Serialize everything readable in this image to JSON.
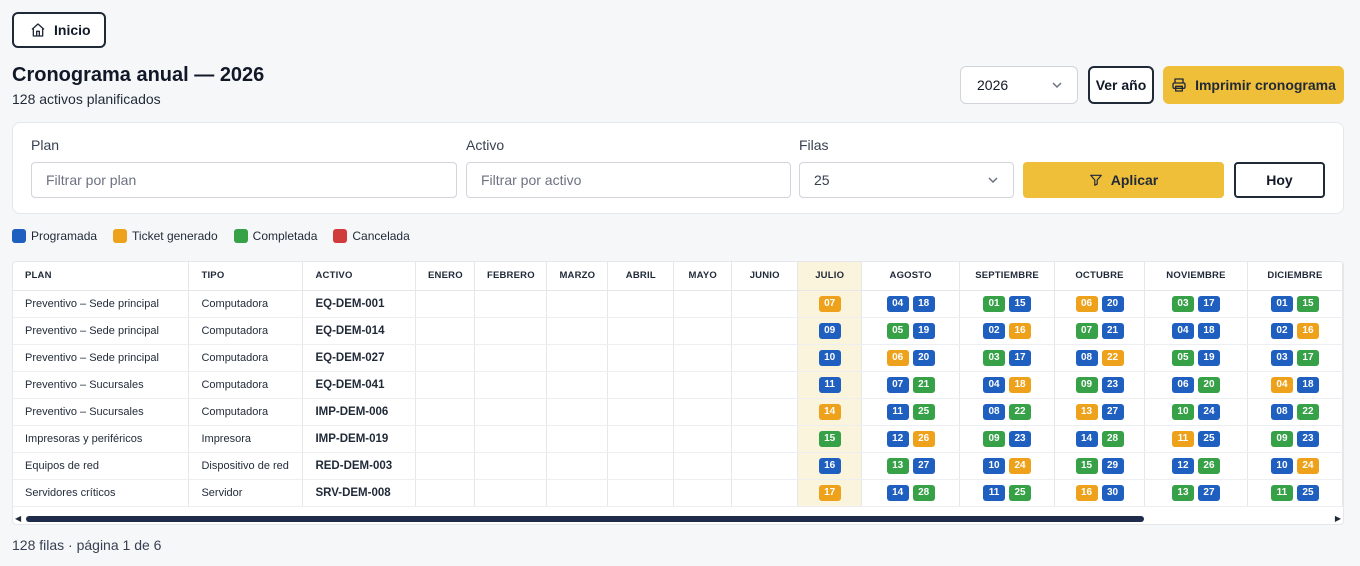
{
  "nav": {
    "home_label": "Inicio"
  },
  "header": {
    "title": "Cronograma anual — 2026",
    "subtitle": "128 activos planificados",
    "year_value": "2026",
    "ver_label": "Ver año",
    "print_label": "Imprimir cronograma"
  },
  "filters": {
    "plan_label": "Plan",
    "plan_placeholder": "Filtrar por plan",
    "activo_label": "Activo",
    "activo_placeholder": "Filtrar por activo",
    "filas_label": "Filas",
    "filas_value": "25",
    "apply_label": "Aplicar",
    "hoy_label": "Hoy"
  },
  "colors": {
    "P": "#1f5fbf",
    "T": "#eea21b",
    "C": "#36a146",
    "X": "#d23b3b",
    "accent": "#f0bf3a"
  },
  "legend": [
    {
      "key": "P",
      "label": "Programada"
    },
    {
      "key": "T",
      "label": "Ticket generado"
    },
    {
      "key": "C",
      "label": "Completada"
    },
    {
      "key": "X",
      "label": "Cancelada"
    }
  ],
  "table": {
    "columns": {
      "plan": "PLAN",
      "tipo": "TIPO",
      "activo": "ACTIVO",
      "months": [
        "ENERO",
        "FEBRERO",
        "MARZO",
        "ABRIL",
        "MAYO",
        "JUNIO",
        "JULIO",
        "AGOSTO",
        "SEPTIEMBRE",
        "OCTUBRE",
        "NOVIEMBRE",
        "DICIEMBRE"
      ]
    },
    "rows": [
      {
        "plan": "Preventivo – Sede principal",
        "tipo": "Computadora",
        "activo": "EQ-DEM-001",
        "months": [
          [],
          [],
          [],
          [],
          [],
          [],
          [
            [
              "07",
              "T"
            ]
          ],
          [
            [
              "04",
              "P"
            ],
            [
              "18",
              "P"
            ]
          ],
          [
            [
              "01",
              "C"
            ],
            [
              "15",
              "P"
            ]
          ],
          [
            [
              "06",
              "T"
            ],
            [
              "20",
              "P"
            ]
          ],
          [
            [
              "03",
              "C"
            ],
            [
              "17",
              "P"
            ]
          ],
          [
            [
              "01",
              "P"
            ],
            [
              "15",
              "C"
            ]
          ]
        ]
      },
      {
        "plan": "Preventivo – Sede principal",
        "tipo": "Computadora",
        "activo": "EQ-DEM-014",
        "months": [
          [],
          [],
          [],
          [],
          [],
          [],
          [
            [
              "09",
              "P"
            ]
          ],
          [
            [
              "05",
              "C"
            ],
            [
              "19",
              "P"
            ]
          ],
          [
            [
              "02",
              "P"
            ],
            [
              "16",
              "T"
            ]
          ],
          [
            [
              "07",
              "C"
            ],
            [
              "21",
              "P"
            ]
          ],
          [
            [
              "04",
              "P"
            ],
            [
              "18",
              "P"
            ]
          ],
          [
            [
              "02",
              "P"
            ],
            [
              "16",
              "T"
            ]
          ]
        ]
      },
      {
        "plan": "Preventivo – Sede principal",
        "tipo": "Computadora",
        "activo": "EQ-DEM-027",
        "months": [
          [],
          [],
          [],
          [],
          [],
          [],
          [
            [
              "10",
              "P"
            ]
          ],
          [
            [
              "06",
              "T"
            ],
            [
              "20",
              "P"
            ]
          ],
          [
            [
              "03",
              "C"
            ],
            [
              "17",
              "P"
            ]
          ],
          [
            [
              "08",
              "P"
            ],
            [
              "22",
              "T"
            ]
          ],
          [
            [
              "05",
              "C"
            ],
            [
              "19",
              "P"
            ]
          ],
          [
            [
              "03",
              "P"
            ],
            [
              "17",
              "C"
            ]
          ]
        ]
      },
      {
        "plan": "Preventivo – Sucursales",
        "tipo": "Computadora",
        "activo": "EQ-DEM-041",
        "months": [
          [],
          [],
          [],
          [],
          [],
          [],
          [
            [
              "11",
              "P"
            ]
          ],
          [
            [
              "07",
              "P"
            ],
            [
              "21",
              "C"
            ]
          ],
          [
            [
              "04",
              "P"
            ],
            [
              "18",
              "T"
            ]
          ],
          [
            [
              "09",
              "C"
            ],
            [
              "23",
              "P"
            ]
          ],
          [
            [
              "06",
              "P"
            ],
            [
              "20",
              "C"
            ]
          ],
          [
            [
              "04",
              "T"
            ],
            [
              "18",
              "P"
            ]
          ]
        ]
      },
      {
        "plan": "Preventivo – Sucursales",
        "tipo": "Computadora",
        "activo": "IMP-DEM-006",
        "months": [
          [],
          [],
          [],
          [],
          [],
          [],
          [
            [
              "14",
              "T"
            ]
          ],
          [
            [
              "11",
              "P"
            ],
            [
              "25",
              "C"
            ]
          ],
          [
            [
              "08",
              "P"
            ],
            [
              "22",
              "C"
            ]
          ],
          [
            [
              "13",
              "T"
            ],
            [
              "27",
              "P"
            ]
          ],
          [
            [
              "10",
              "C"
            ],
            [
              "24",
              "P"
            ]
          ],
          [
            [
              "08",
              "P"
            ],
            [
              "22",
              "C"
            ]
          ]
        ]
      },
      {
        "plan": "Impresoras y periféricos",
        "tipo": "Impresora",
        "activo": "IMP-DEM-019",
        "months": [
          [],
          [],
          [],
          [],
          [],
          [],
          [
            [
              "15",
              "C"
            ]
          ],
          [
            [
              "12",
              "P"
            ],
            [
              "26",
              "T"
            ]
          ],
          [
            [
              "09",
              "C"
            ],
            [
              "23",
              "P"
            ]
          ],
          [
            [
              "14",
              "P"
            ],
            [
              "28",
              "C"
            ]
          ],
          [
            [
              "11",
              "T"
            ],
            [
              "25",
              "P"
            ]
          ],
          [
            [
              "09",
              "C"
            ],
            [
              "23",
              "P"
            ]
          ]
        ]
      },
      {
        "plan": "Equipos de red",
        "tipo": "Dispositivo de red",
        "activo": "RED-DEM-003",
        "months": [
          [],
          [],
          [],
          [],
          [],
          [],
          [
            [
              "16",
              "P"
            ]
          ],
          [
            [
              "13",
              "C"
            ],
            [
              "27",
              "P"
            ]
          ],
          [
            [
              "10",
              "P"
            ],
            [
              "24",
              "T"
            ]
          ],
          [
            [
              "15",
              "C"
            ],
            [
              "29",
              "P"
            ]
          ],
          [
            [
              "12",
              "P"
            ],
            [
              "26",
              "C"
            ]
          ],
          [
            [
              "10",
              "P"
            ],
            [
              "24",
              "T"
            ]
          ]
        ]
      },
      {
        "plan": "Servidores críticos",
        "tipo": "Servidor",
        "activo": "SRV-DEM-008",
        "months": [
          [],
          [],
          [],
          [],
          [],
          [],
          [
            [
              "17",
              "T"
            ]
          ],
          [
            [
              "14",
              "P"
            ],
            [
              "28",
              "C"
            ]
          ],
          [
            [
              "11",
              "P"
            ],
            [
              "25",
              "C"
            ]
          ],
          [
            [
              "16",
              "T"
            ],
            [
              "30",
              "P"
            ]
          ],
          [
            [
              "13",
              "C"
            ],
            [
              "27",
              "P"
            ]
          ],
          [
            [
              "11",
              "C"
            ],
            [
              "25",
              "P"
            ]
          ]
        ]
      }
    ]
  },
  "footer": {
    "text": "128 filas · página 1 de 6"
  }
}
